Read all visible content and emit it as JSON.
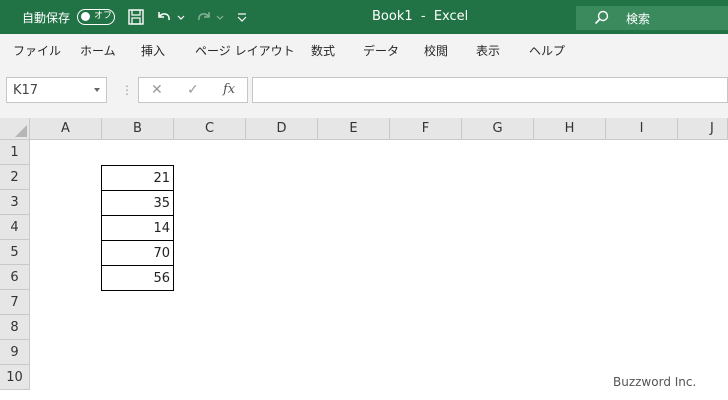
{
  "titlebar": {
    "autosave_label": "自動保存",
    "toggle_text": "オフ",
    "title": "Book1  -  Excel",
    "search_placeholder": "検索",
    "icons": [
      "save-icon",
      "undo-icon",
      "redo-icon",
      "customize-qat-icon",
      "search-icon"
    ],
    "accent_color": "#217346"
  },
  "ribbon": {
    "tabs": [
      "ファイル",
      "ホーム",
      "挿入",
      "ページ レイアウト",
      "数式",
      "データ",
      "校閲",
      "表示",
      "ヘルプ"
    ]
  },
  "formula_bar": {
    "name_box": "K17",
    "cancel": "✕",
    "enter": "✓",
    "fx": "fx",
    "formula": ""
  },
  "sheet": {
    "columns": [
      "A",
      "B",
      "C",
      "D",
      "E",
      "F",
      "G",
      "H",
      "I",
      "J"
    ],
    "rows": [
      "1",
      "2",
      "3",
      "4",
      "5",
      "6",
      "7",
      "8",
      "9",
      "10"
    ],
    "cells": {
      "B2": "21",
      "B3": "35",
      "B4": "14",
      "B5": "70",
      "B6": "56"
    }
  },
  "watermark": "Buzzword Inc."
}
